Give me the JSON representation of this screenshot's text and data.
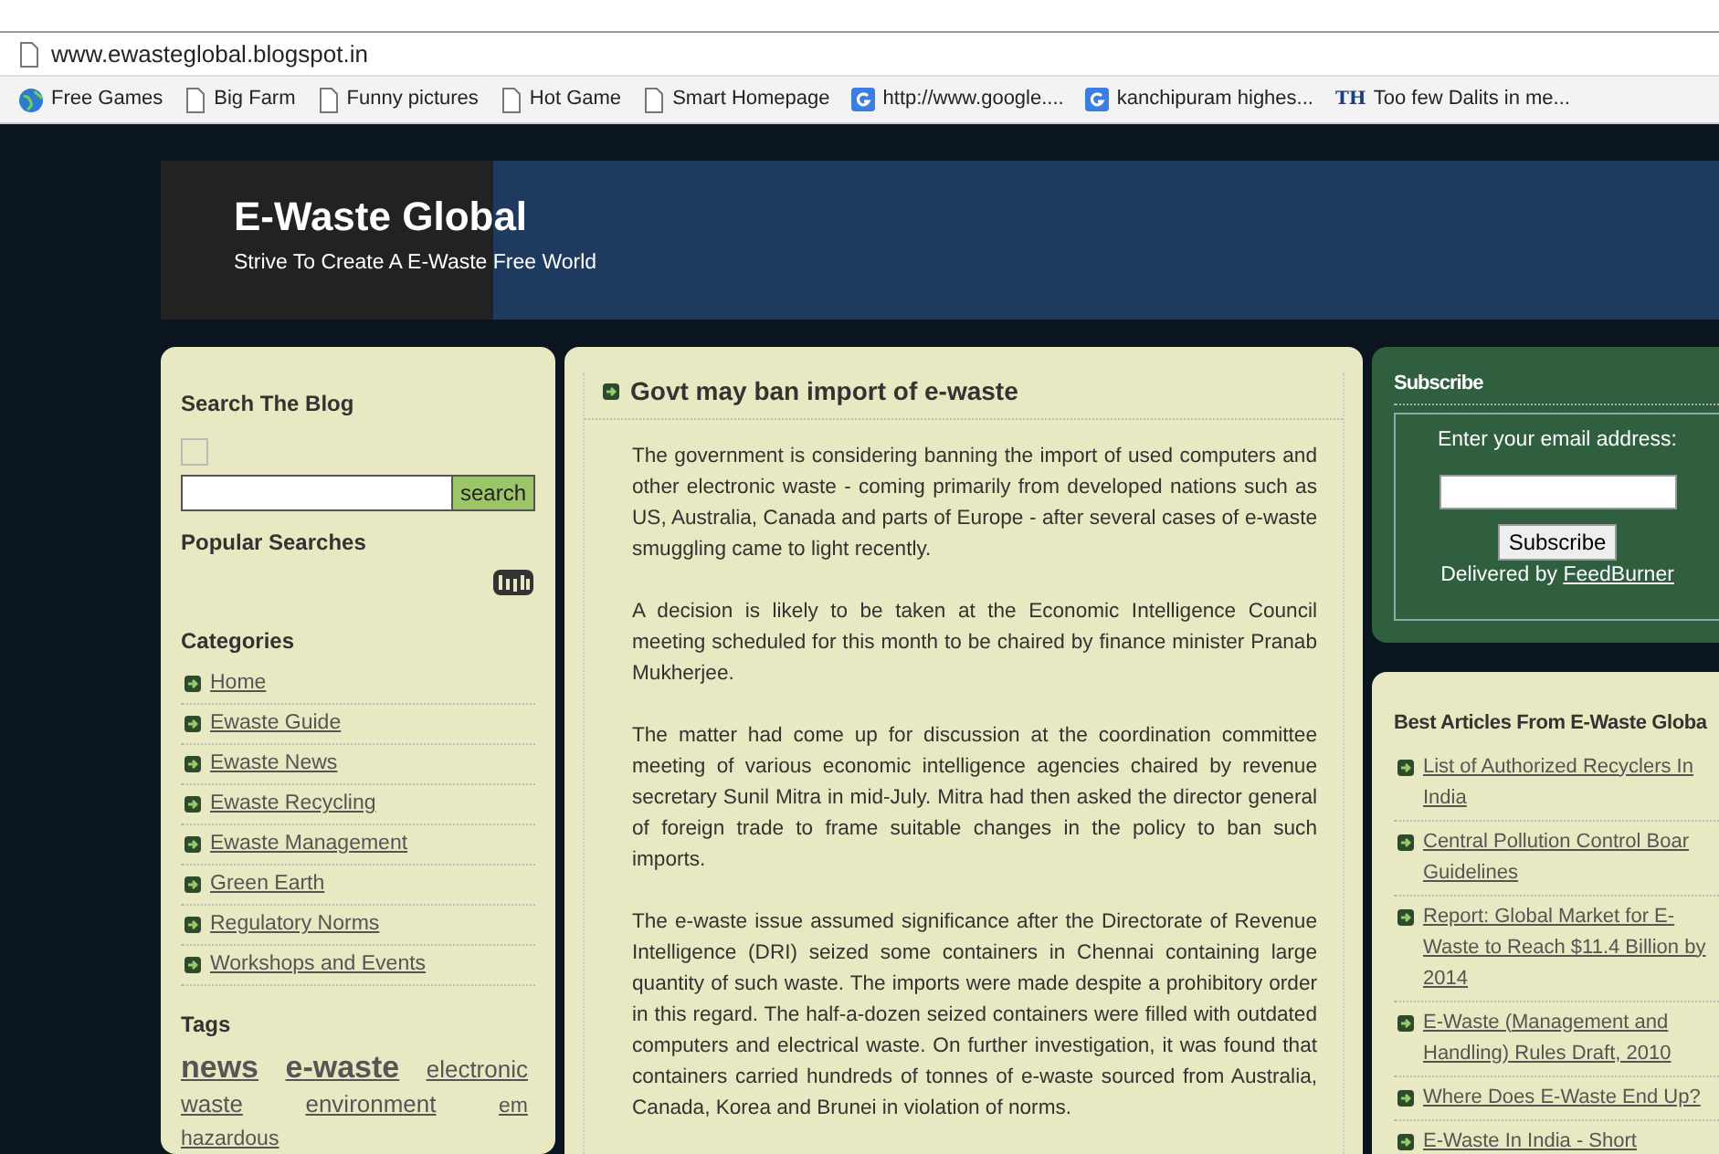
{
  "address_bar": {
    "url": "www.ewasteglobal.blogspot.in"
  },
  "bookmarks": [
    {
      "kind": "globe",
      "label": "Free Games"
    },
    {
      "kind": "page",
      "label": "Big Farm"
    },
    {
      "kind": "page",
      "label": "Funny pictures"
    },
    {
      "kind": "page",
      "label": "Hot Game"
    },
    {
      "kind": "page",
      "label": "Smart Homepage"
    },
    {
      "kind": "google",
      "label": "http://www.google...."
    },
    {
      "kind": "google",
      "label": "kanchipuram highes..."
    },
    {
      "kind": "logo",
      "logo_text": "TH",
      "label": "Too few Dalits in me..."
    }
  ],
  "header": {
    "title": "E-Waste Global",
    "tagline": "Strive To Create A E-Waste Free World"
  },
  "sidebar": {
    "search_title": "Search The Blog",
    "search_button": "search",
    "popular_title": "Popular Searches",
    "categories_title": "Categories",
    "categories": [
      "Home",
      "Ewaste Guide",
      "Ewaste News",
      "Ewaste Recycling",
      "Ewaste Management",
      "Green Earth",
      "Regulatory Norms",
      "Workshops and Events"
    ],
    "tags_title": "Tags",
    "search_checkbox": {
      "checked": false
    },
    "tags": [
      {
        "label": "news",
        "kind": "large"
      },
      {
        "label": "e-waste",
        "kind": "large"
      },
      {
        "label": "electronic",
        "kind": "medium"
      },
      {
        "label": "waste",
        "kind": "medium"
      },
      {
        "label": "environment",
        "kind": "medium"
      },
      {
        "label": "em",
        "kind": "small"
      },
      {
        "label": "hazardous",
        "kind": "small"
      }
    ]
  },
  "post": {
    "title": "Govt may ban import of e-waste",
    "paragraphs": [
      "The government is considering banning the import of used computers and other electronic waste - coming primarily from developed nations such as US, Australia, Canada and parts of Europe - after several cases of e-waste smuggling came to light recently.",
      "A decision is likely to be taken at the Economic Intelligence Council meeting scheduled for this month to be chaired by finance minister Pranab Mukherjee.",
      "The matter had come up for discussion at the coordination committee meeting of various economic intelligence agencies chaired by revenue secretary Sunil Mitra in mid-July. Mitra had then asked the director general of foreign trade to frame suitable changes in the policy to ban such imports.",
      "The e-waste issue assumed significance after the Directorate of Revenue Intelligence (DRI) seized some containers in Chennai containing large quantity of such waste. The imports were made despite a prohibitory order in this regard. The half-a-dozen seized containers were filled with outdated computers and electrical waste. On further investigation, it was found that containers carried hundreds of tonnes of e-waste sourced from Australia, Canada, Korea and Brunei in violation of norms."
    ]
  },
  "subscribe": {
    "title": "Subscribe",
    "prompt": "Enter your email address:",
    "button": "Subscribe",
    "delivered_by": "Delivered by",
    "feedburner": "FeedBurner"
  },
  "best_articles": {
    "title": "Best Articles From E-Waste Globa",
    "items": [
      [
        "List of Authorized Recyclers In",
        "India"
      ],
      [
        "Central Pollution Control Boar",
        "Guidelines"
      ],
      [
        "Report: Global Market for E-",
        "Waste to Reach $11.4 Billion by",
        "2014"
      ],
      [
        "E-Waste (Management and",
        "Handling) Rules Draft, 2010"
      ],
      [
        "Where Does E-Waste End Up?"
      ],
      [
        "E-Waste In India - Short"
      ]
    ]
  }
}
